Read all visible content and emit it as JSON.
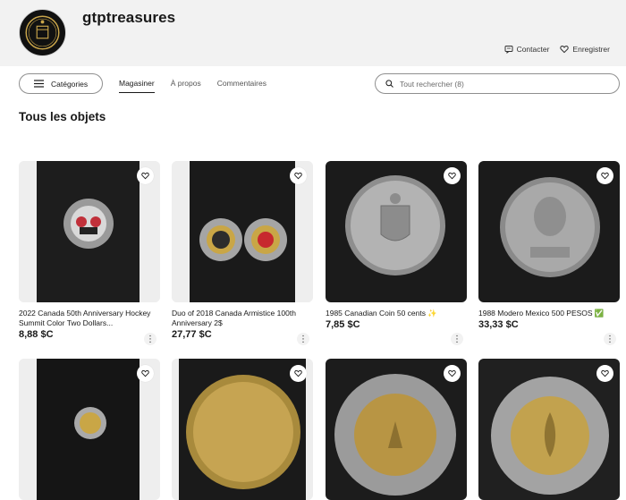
{
  "shop": {
    "name": "gtptreasures",
    "logo_text": "G T P",
    "actions": [
      {
        "label": "Contacter",
        "icon": "message-icon"
      },
      {
        "label": "Enregistrer",
        "icon": "heart-icon"
      }
    ]
  },
  "nav": {
    "categories_label": "Catégories",
    "tabs": [
      {
        "label": "Magasiner",
        "active": true
      },
      {
        "label": "À propos",
        "active": false
      },
      {
        "label": "Commentaires",
        "active": false
      }
    ],
    "search_placeholder": "Tout rechercher (8)"
  },
  "section_title": "Tous les objets",
  "items": [
    {
      "title": "2022 Canada 50th Anniversary Hockey Summit Color Two Dollars...",
      "price": "8,88 $C"
    },
    {
      "title": "Duo of 2018 Canada Armistice 100th Anniversary 2$",
      "price": "27,77 $C"
    },
    {
      "title": "1985 Canadian Coin 50 cents ✨",
      "price": "7,85 $C"
    },
    {
      "title": "1988 Modero Mexico 500 PESOS ✅",
      "price": "33,33 $C"
    },
    {
      "title": "",
      "price": ""
    },
    {
      "title": "",
      "price": ""
    },
    {
      "title": "",
      "price": ""
    },
    {
      "title": "",
      "price": ""
    }
  ],
  "colors": {
    "header_bg": "#f2f2f2",
    "text": "#191919",
    "border": "#8f8f8f"
  }
}
